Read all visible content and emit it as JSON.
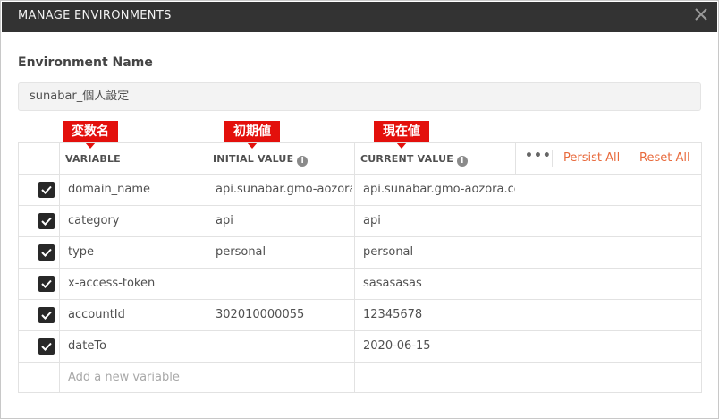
{
  "window": {
    "title": "MANAGE ENVIRONMENTS"
  },
  "environment": {
    "label": "Environment Name",
    "value": "sunabar_個人設定"
  },
  "table": {
    "headers": {
      "variable": "VARIABLE",
      "initial": "INITIAL VALUE",
      "current": "CURRENT VALUE"
    },
    "actions": {
      "more": "•••",
      "persist_all": "Persist All",
      "reset_all": "Reset All"
    },
    "rows": [
      {
        "variable": "domain_name",
        "initial": "api.sunabar.gmo-aozora.com",
        "current": "api.sunabar.gmo-aozora.com",
        "checked": true
      },
      {
        "variable": "category",
        "initial": "api",
        "current": "api",
        "checked": true
      },
      {
        "variable": "type",
        "initial": "personal",
        "current": "personal",
        "checked": true
      },
      {
        "variable": "x-access-token",
        "initial": "",
        "current": "sasasasas",
        "checked": true
      },
      {
        "variable": "accountId",
        "initial": "302010000055",
        "current": "12345678",
        "checked": true
      },
      {
        "variable": "dateTo",
        "initial": "",
        "current": "2020-06-15",
        "checked": true
      }
    ],
    "add_placeholder": "Add a new variable"
  },
  "annotations": {
    "variable": "変数名",
    "initial": "初期値",
    "current": "現在値"
  },
  "icons": {
    "close": "close-icon",
    "info": "info-icon",
    "check": "check-icon"
  },
  "colors": {
    "accent": "#e86a3c",
    "annotation": "#e3100c",
    "titlebar": "#333333"
  }
}
